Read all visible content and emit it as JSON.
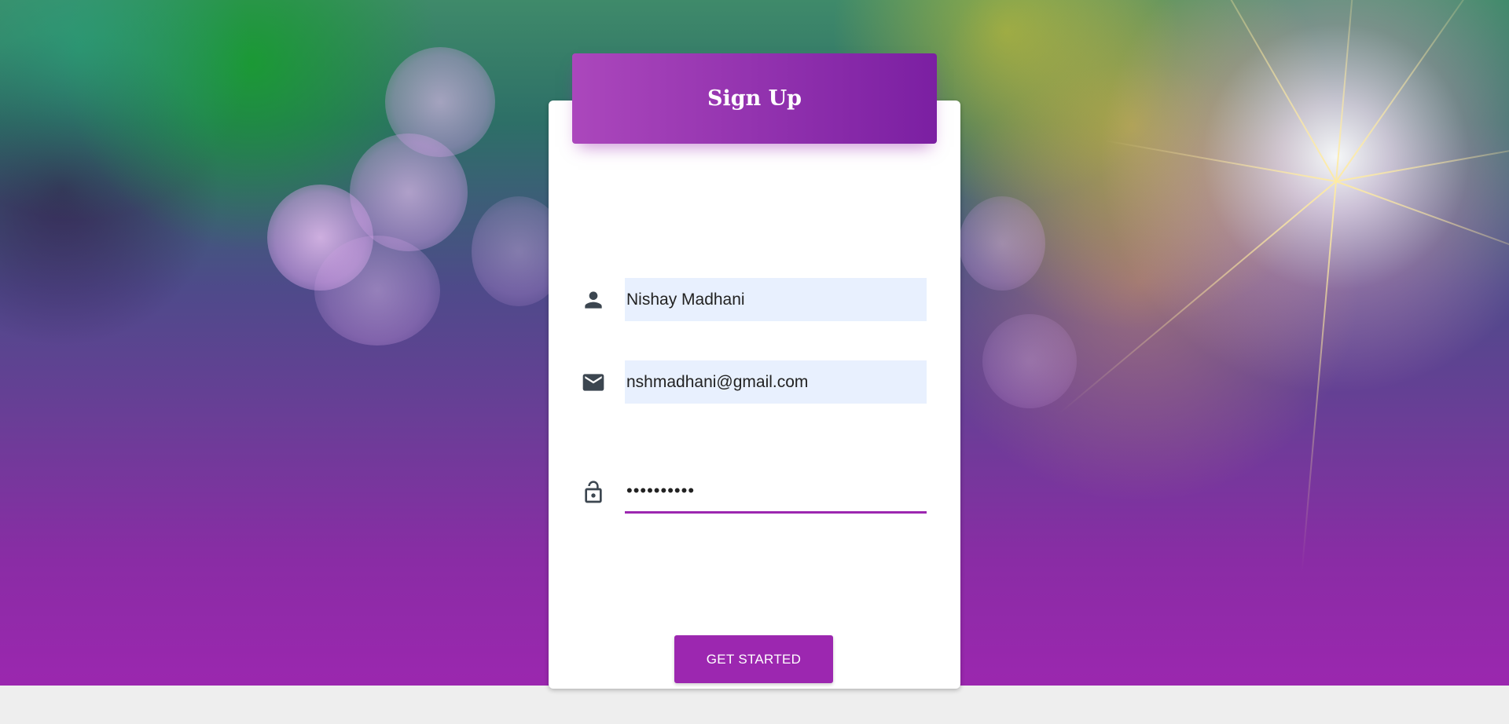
{
  "form": {
    "title": "Sign Up",
    "name": {
      "icon": "person-icon",
      "value": "Nishay Madhani"
    },
    "email": {
      "icon": "email-icon",
      "value": "nshmadhani@gmail.com"
    },
    "password": {
      "icon": "lock-icon",
      "value": "••••••••••"
    },
    "submit_label": "GET STARTED"
  },
  "colors": {
    "accent": "#9c27b0",
    "header_gradient_start": "#ab47bc",
    "header_gradient_end": "#7b1fa2",
    "autofill_background": "#e8f0fe",
    "footer_background": "#eeeeee",
    "icon_color": "#3c4650"
  }
}
